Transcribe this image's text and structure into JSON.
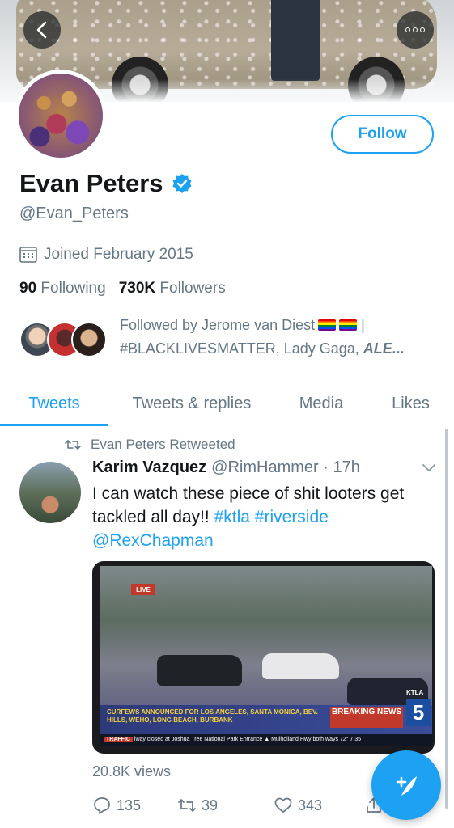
{
  "header": {
    "back_icon": "chevron-left-icon",
    "more_icon": "more-dots-icon"
  },
  "profile": {
    "follow_label": "Follow",
    "display_name": "Evan Peters",
    "handle": "@Evan_Peters",
    "joined": "Joined February 2015",
    "following_count": "90",
    "following_label": "Following",
    "followers_count": "730K",
    "followers_label": "Followers",
    "followed_by_prefix": "Followed by Jerome van Diest",
    "followed_by_sep": "|",
    "followed_by_rest": "#BLACKLIVESMATTER, Lady Gaga,",
    "followed_by_last": "ALE...",
    "accent_color": "#1da1f2"
  },
  "tabs": [
    {
      "label": "Tweets",
      "active": true
    },
    {
      "label": "Tweets & replies",
      "active": false
    },
    {
      "label": "Media",
      "active": false
    },
    {
      "label": "Likes",
      "active": false
    }
  ],
  "tweet": {
    "retweet_context": "Evan Peters Retweeted",
    "author": "Karim Vazquez",
    "meta": "@RimHammer · 17h",
    "text_plain": "I can watch these piece of shit looters get tackled all day!!",
    "hashtag1": "#ktla",
    "hashtag2": "#riverside",
    "mention": "@RexChapman",
    "media": {
      "live_label": "LIVE",
      "lower_third": "CURFEWS ANNOUNCED FOR LOS ANGELES, SANTA MONICA, BEV. HILLS, WEHO, LONG BEACH, BURBANK",
      "breaking": "BREAKING NEWS",
      "channel_label": "KTLA",
      "channel_number": "5",
      "ticker_label": "TRAFFIC",
      "ticker_text": "lway closed at Joshua Tree National Park Entrance  ▲ Mulholland Hwy both ways  72°  7:35"
    },
    "views": "20.8K views",
    "replies": "135",
    "retweets": "39",
    "likes": "343"
  },
  "fab": {
    "icon": "compose-tweet-icon"
  }
}
